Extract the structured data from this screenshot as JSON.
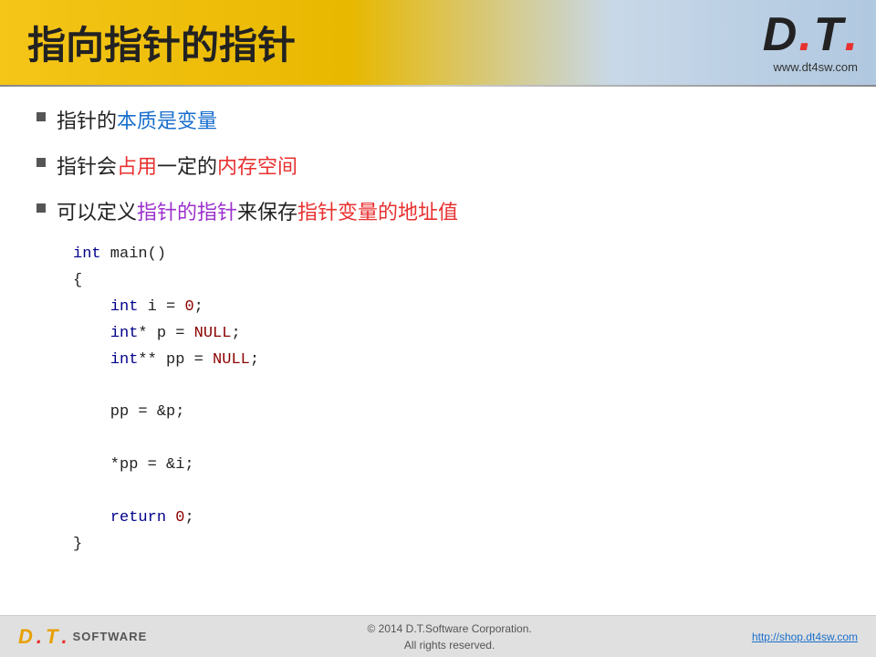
{
  "header": {
    "title": "指向指针的指针",
    "logo": {
      "d": "D",
      "dot1": ".",
      "t": "T",
      "dot2": ".",
      "website": "www.dt4sw.com"
    }
  },
  "bullets": [
    {
      "text_before": "指针的",
      "text_highlight": "本质是变量",
      "text_after": "",
      "highlight_color": "blue"
    },
    {
      "text_before": "指针会",
      "text_highlight": "占用",
      "text_middle": "一定的",
      "text_highlight2": "内存空间",
      "highlight_color": "red"
    },
    {
      "text_before": "可以定义",
      "text_highlight": "指针的指针",
      "text_middle": "来保存",
      "text_highlight2": "指针变量的地址值",
      "highlight_color_1": "purple",
      "highlight_color_2": "red"
    }
  ],
  "code": {
    "lines": [
      "int main()",
      "{",
      "    int i = 0;",
      "    int* p = NULL;",
      "    int** pp = NULL;",
      "",
      "    pp = &p;",
      "",
      "    *pp = &i;",
      "",
      "    return 0;",
      "}"
    ]
  },
  "footer": {
    "logo": {
      "d": "D",
      "dot1": ".",
      "t": "T",
      "dot2": ".",
      "software": "SOFTWARE"
    },
    "copyright_line1": "© 2014 D.T.Software Corporation.",
    "copyright_line2": "All rights reserved.",
    "website_url": "http://shop.dt4sw.com"
  }
}
